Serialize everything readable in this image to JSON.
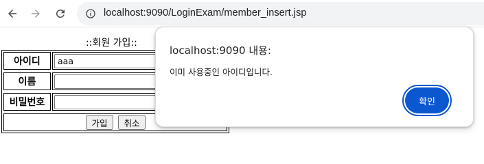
{
  "browser": {
    "url": "localhost:9090/LoginExam/member_insert.jsp",
    "icons": {
      "back": "arrow-back-icon",
      "forward": "arrow-forward-icon",
      "reload": "reload-icon",
      "site_info": "site-info-icon"
    }
  },
  "page": {
    "title": "::회원 가입::",
    "form": {
      "id_label": "아이디",
      "id_value": "aaa",
      "name_label": "이름",
      "name_value": "",
      "password_label": "비밀번호",
      "password_value": "",
      "join_button": "가입",
      "cancel_button": "취소"
    }
  },
  "dialog": {
    "title": "localhost:9090 내용:",
    "message": "이미 사용중인 아이디입니다.",
    "ok_button": "확인",
    "accent_color": "#0b57d0"
  }
}
